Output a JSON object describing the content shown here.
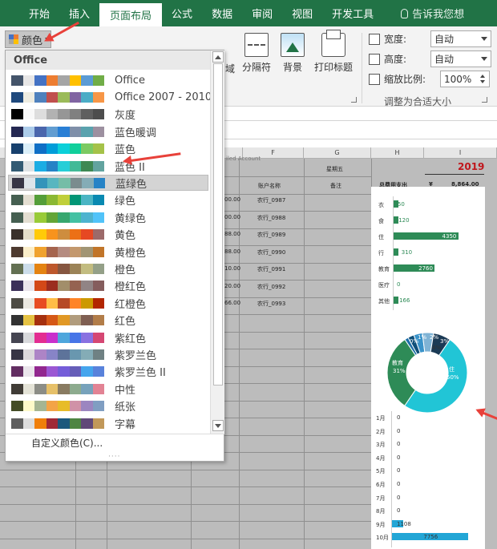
{
  "ribbon_tabs": [
    "开始",
    "插入",
    "页面布局",
    "公式",
    "数据",
    "审阅",
    "视图",
    "开发工具"
  ],
  "tell_me": "告诉我您想",
  "colors_button": {
    "label": "颜色",
    "quad_colors": [
      "#4472c4",
      "#ed7d31",
      "#a5a5a5",
      "#ffc000"
    ]
  },
  "ribbon": {
    "area_label": "域",
    "breaks": "分隔符",
    "background": "背景",
    "print_titles": "打印标题",
    "scale_group": {
      "width_label": "宽度:",
      "width_value": "自动",
      "height_label": "高度:",
      "height_value": "自动",
      "scale_label": "缩放比例:",
      "scale_value": "100%",
      "group_label": "调整为合适大小"
    }
  },
  "colors_dropdown": {
    "header": "Office",
    "hovered_index": 6,
    "themes": [
      {
        "name": "Office",
        "colors": [
          "#44546a",
          "#e7e6e6",
          "#4472c4",
          "#ed7d31",
          "#a5a5a5",
          "#ffc000",
          "#5b9bd5",
          "#70ad47"
        ]
      },
      {
        "name": "Office 2007 - 2010",
        "colors": [
          "#1f497d",
          "#eeece1",
          "#4f81bd",
          "#c0504d",
          "#9bbb59",
          "#8064a2",
          "#4bacc6",
          "#f79646"
        ]
      },
      {
        "name": "灰度",
        "colors": [
          "#000000",
          "#f8f8f8",
          "#dddddd",
          "#b2b2b2",
          "#969696",
          "#808080",
          "#5f5f5f",
          "#4d4d4d"
        ]
      },
      {
        "name": "蓝色暖调",
        "colors": [
          "#242852",
          "#acccea",
          "#4a66ac",
          "#629dd1",
          "#297fd5",
          "#7f8fa9",
          "#5aa2ae",
          "#9d90a0"
        ]
      },
      {
        "name": "蓝色",
        "colors": [
          "#17406d",
          "#dbeff9",
          "#0f6fc6",
          "#009dd9",
          "#0bd0d9",
          "#10cf9b",
          "#7cca62",
          "#a5c249"
        ]
      },
      {
        "name": "蓝色 II",
        "colors": [
          "#335b74",
          "#dfe3e5",
          "#1cade4",
          "#2683c6",
          "#27ced7",
          "#42ba97",
          "#3e8853",
          "#62a39f"
        ]
      },
      {
        "name": "蓝绿色",
        "colors": [
          "#373545",
          "#dee5ea",
          "#3494ba",
          "#58b6c0",
          "#75bda7",
          "#7a8c8e",
          "#84acb6",
          "#2683c6"
        ]
      },
      {
        "name": "绿色",
        "colors": [
          "#455f51",
          "#e3ded1",
          "#549e39",
          "#8ab833",
          "#c0cf3a",
          "#029676",
          "#4ab5c4",
          "#0989b1"
        ]
      },
      {
        "name": "黄绿色",
        "colors": [
          "#455f51",
          "#e3ded1",
          "#99cb38",
          "#63a537",
          "#37a76f",
          "#44c1a3",
          "#4eb3cf",
          "#51c3f9"
        ]
      },
      {
        "name": "黄色",
        "colors": [
          "#39302a",
          "#e5dec9",
          "#ffca08",
          "#f8931d",
          "#ce8d3e",
          "#ec7016",
          "#e64823",
          "#9c6a6a"
        ]
      },
      {
        "name": "黄橙色",
        "colors": [
          "#4e3b30",
          "#fbeec9",
          "#f0a22e",
          "#a5644e",
          "#b58b80",
          "#c3986d",
          "#a19574",
          "#c17529"
        ]
      },
      {
        "name": "橙色",
        "colors": [
          "#637052",
          "#ccddea",
          "#e48312",
          "#bd582c",
          "#865640",
          "#9b8357",
          "#c2bc80",
          "#94a088"
        ]
      },
      {
        "name": "橙红色",
        "colors": [
          "#3b3059",
          "#eae5eb",
          "#d34817",
          "#9b2d1f",
          "#a28e6a",
          "#956251",
          "#918485",
          "#855d5d"
        ]
      },
      {
        "name": "红橙色",
        "colors": [
          "#4d4b44",
          "#ebe8e1",
          "#e84c22",
          "#ffbd47",
          "#b64926",
          "#ff8427",
          "#cc9900",
          "#b22600"
        ]
      },
      {
        "name": "红色",
        "colors": [
          "#323232",
          "#e5c243",
          "#a5300f",
          "#d55816",
          "#e19825",
          "#b19c7d",
          "#7f5f52",
          "#b27d49"
        ]
      },
      {
        "name": "紫红色",
        "colors": [
          "#454551",
          "#d8d9dc",
          "#e32d91",
          "#c830cc",
          "#4ea6dc",
          "#4775e7",
          "#8971e1",
          "#d54773"
        ]
      },
      {
        "name": "紫罗兰色",
        "colors": [
          "#373545",
          "#dcd8dc",
          "#ad84c6",
          "#8784c7",
          "#5d739a",
          "#6997af",
          "#84acb6",
          "#6f8183"
        ]
      },
      {
        "name": "紫罗兰色 II",
        "colors": [
          "#632e62",
          "#eae5eb",
          "#92278f",
          "#9b57d3",
          "#755dd9",
          "#665eb8",
          "#45a5ed",
          "#5982db"
        ]
      },
      {
        "name": "中性",
        "colors": [
          "#403c36",
          "#e4e3d7",
          "#8c8d86",
          "#e6c069",
          "#897b61",
          "#8dab8e",
          "#77a2bb",
          "#e28394"
        ]
      },
      {
        "name": "纸张",
        "colors": [
          "#444d26",
          "#fefac9",
          "#a5b592",
          "#f3a447",
          "#e7bc29",
          "#d092a7",
          "#9c85c0",
          "#809ec2"
        ]
      },
      {
        "name": "字幕",
        "colors": [
          "#5e5e5e",
          "#dddddd",
          "#f07f09",
          "#9f2936",
          "#1b587c",
          "#4e8542",
          "#604878",
          "#c19859"
        ]
      }
    ],
    "customize": "自定义颜色(C)..."
  },
  "sheet": {
    "col_headers": [
      "F",
      "G",
      "H",
      "I"
    ],
    "top_text": "iled Account",
    "header_cells": {
      "account_name": "账户名称",
      "remark": "备注",
      "weekday": "星期五",
      "year": "2019"
    },
    "amounts": [
      "00.00",
      "00.00",
      "88.00",
      "88.00",
      "10.00",
      "20.00",
      "66.00"
    ],
    "accounts": [
      "农行_0987",
      "农行_0988",
      "农行_0989",
      "农行_0990",
      "农行_0991",
      "农行_0992",
      "农行_0993"
    ],
    "total_label": "总费用支出",
    "total_currency": "¥",
    "total_value": "8,864.00"
  },
  "chart_data": [
    {
      "type": "bar",
      "categories": [
        "衣",
        "食",
        "住",
        "行",
        "教育",
        "医疗",
        "其他"
      ],
      "values": [
        50,
        120,
        4350,
        310,
        2760,
        0,
        166
      ],
      "value_labels": [
        "50",
        "120",
        "4350",
        "310",
        "2760",
        "0",
        "166"
      ],
      "xlim": [
        0,
        5400
      ],
      "color": "#2e8b57"
    },
    {
      "type": "pie",
      "slice_labels": [
        "住",
        "教育",
        "0%",
        "1%",
        "2%",
        "3%",
        "4%"
      ],
      "slice_values": [
        "50%",
        "31%"
      ],
      "colors": [
        "#21c5d6",
        "#2e8b57",
        "#1e6fa8",
        "#0e4f7a",
        "#3a93c9",
        "#7fb3d5",
        "#1b3a55"
      ]
    },
    {
      "type": "bar",
      "categories": [
        "1月",
        "2月",
        "3月",
        "4月",
        "5月",
        "6月",
        "7月",
        "8月",
        "9月",
        "10月"
      ],
      "values": [
        0,
        0,
        0,
        0,
        0,
        0,
        0,
        0,
        1108,
        7756
      ],
      "value_labels": [
        "0",
        "0",
        "0",
        "0",
        "0",
        "0",
        "0",
        "0",
        "1108",
        "7756"
      ],
      "xlim": [
        0,
        9000
      ],
      "color": "#22a6d6"
    }
  ]
}
